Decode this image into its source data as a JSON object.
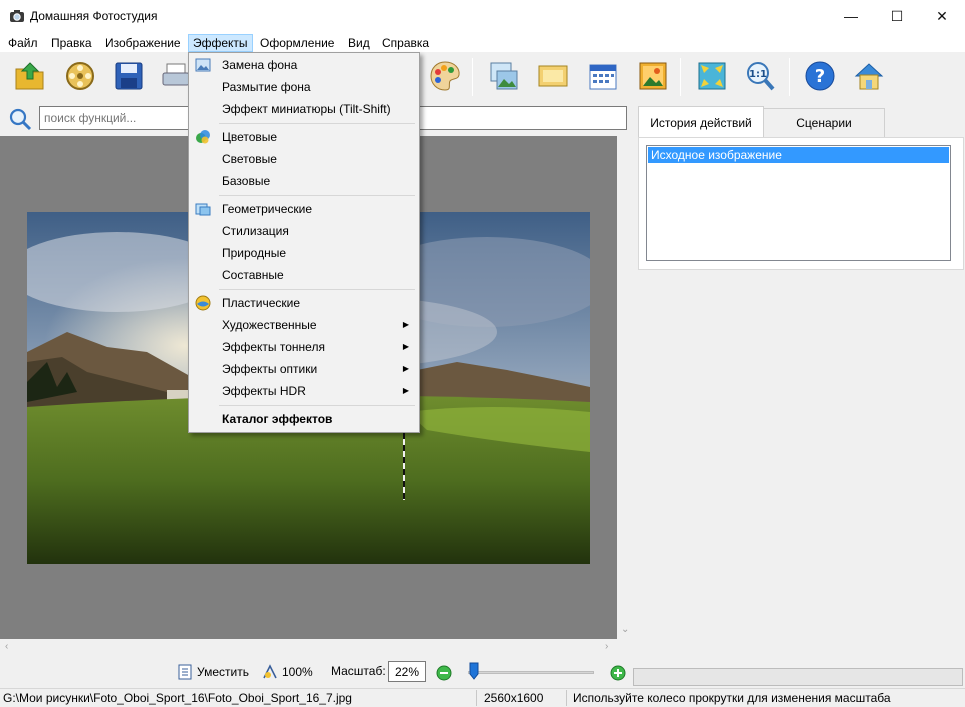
{
  "window": {
    "title": "Домашняя Фотостудия",
    "minimize_glyph": "—",
    "maximize_glyph": "☐",
    "close_glyph": "✕"
  },
  "menubar": [
    {
      "label": "Файл"
    },
    {
      "label": "Правка"
    },
    {
      "label": "Изображение"
    },
    {
      "label": "Эффекты",
      "active": true
    },
    {
      "label": "Оформление"
    },
    {
      "label": "Вид"
    },
    {
      "label": "Справка"
    }
  ],
  "toolbar": {
    "buttons": [
      {
        "icon": "open-folder-icon"
      },
      {
        "icon": "film-reel-icon"
      },
      {
        "icon": "save-floppy-icon"
      },
      {
        "icon": "print-icon"
      },
      {
        "icon": "palette-icon"
      },
      {
        "icon": "image-frame-icon"
      },
      {
        "icon": "postcard-icon"
      },
      {
        "icon": "calendar-icon"
      },
      {
        "icon": "photo-collage-icon"
      },
      {
        "icon": "fit-screen-icon"
      },
      {
        "icon": "actual-size-icon"
      },
      {
        "icon": "help-icon"
      },
      {
        "icon": "home-icon"
      }
    ]
  },
  "search": {
    "placeholder": "поиск функций..."
  },
  "effects_menu": {
    "groups": [
      [
        {
          "label": "Замена фона",
          "icon": "background-replace-icon"
        },
        {
          "label": "Размытие фона"
        },
        {
          "label": "Эффект миниатюры (Tilt-Shift)"
        }
      ],
      [
        {
          "label": "Цветовые",
          "icon": "color-effects-icon"
        },
        {
          "label": "Световые"
        },
        {
          "label": "Базовые"
        }
      ],
      [
        {
          "label": "Геометрические",
          "icon": "geometric-icon"
        },
        {
          "label": "Стилизация"
        },
        {
          "label": "Природные"
        },
        {
          "label": "Составные"
        }
      ],
      [
        {
          "label": "Пластические",
          "icon": "plastic-icon"
        },
        {
          "label": "Художественные",
          "submenu": true
        },
        {
          "label": "Эффекты тоннеля",
          "submenu": true
        },
        {
          "label": "Эффекты оптики",
          "submenu": true
        },
        {
          "label": "Эффекты HDR",
          "submenu": true
        }
      ],
      [
        {
          "label": "Каталог эффектов",
          "bold": true
        }
      ]
    ]
  },
  "right_panel": {
    "tabs": [
      {
        "label": "История действий",
        "active": true
      },
      {
        "label": "Сценарии"
      }
    ],
    "history": [
      "Исходное изображение"
    ]
  },
  "zoombar": {
    "fit_label": "Уместить",
    "actual_label": "100%",
    "scale_label": "Масштаб:",
    "zoom_value": "22%",
    "slider_fraction": 0.05
  },
  "statusbar": {
    "path": "G:\\Мои рисунки\\Foto_Oboi_Sport_16\\Foto_Oboi_Sport_16_7.jpg",
    "dimensions": "2560x1600",
    "hint": "Используйте колесо прокрутки для изменения масштаба"
  },
  "colors": {
    "selection": "#3399ff",
    "canvas_bg": "#7f7f7f",
    "menu_active": "#cce8ff"
  }
}
